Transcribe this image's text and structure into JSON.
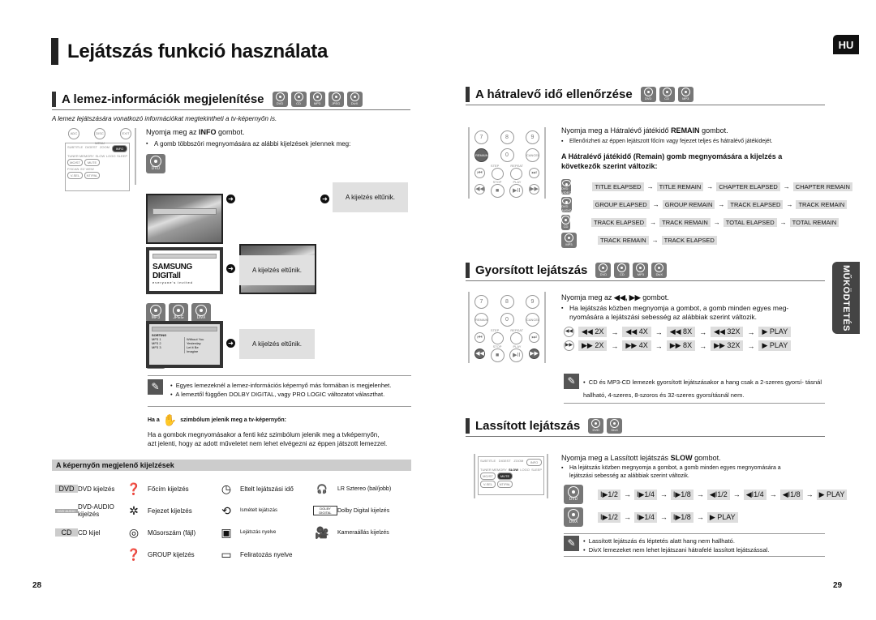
{
  "header": {
    "title": "Lejátszás funkció használata",
    "lang_tab": "HU",
    "side_tab": "MŰKÖDTETÉS"
  },
  "left": {
    "section1": {
      "title": "A lemez-információk megjelenítése",
      "discs": [
        "DVD",
        "CD",
        "MP3",
        "JPEG",
        "DivX"
      ],
      "intro": "A lemez lejátszására vonatkozó információkat megtekintheti a tv-képernyőn is.",
      "instruction_pre": "Nyomja meg az ",
      "instruction_bold": "INFO",
      "instruction_post": " gombot.",
      "bullet": "A gomb többszöri megnyomására az alábbi kijelzések jelennek meg:",
      "remote": {
        "top": [
          "ADC",
          "DISC MENU",
          "EXIT"
        ],
        "row1": [
          "SUBTITLE",
          "DIGEST",
          "ZOOM",
          "INFO"
        ],
        "row2": [
          "TUNER MEMORY",
          "SLOW",
          "LOGO",
          "SLEEP"
        ],
        "row3": [
          "P.SCAN",
          "EZ VIEW"
        ],
        "btns2": [
          "MO/ST",
          "MUTE"
        ],
        "btns3": [
          "V-SEL",
          "NT/PAL"
        ]
      },
      "dvd_label": "DVD",
      "cd_label": "CD",
      "group_discs": [
        "MP3",
        "JPEG",
        "DivX"
      ],
      "disappear": "A kijelzés eltűnik.",
      "samsung_logo": "SAMSUNG DIGITall",
      "samsung_tag": "everyone's invited",
      "mp3_screen": {
        "sorting": "SORTING",
        "files": [
          "MP3 1",
          "MP3 2",
          "MP3 3"
        ],
        "tracks": [
          "Without You",
          "Yesterday",
          "Let it Be",
          "Imagine"
        ]
      },
      "notes": [
        "Egyes lemezeknél a lemez-információs képernyő más formában is megjelenhet.",
        "A lemeztől függően DOLBY DIGITAL, vagy PRO LOGIC változatot választhat."
      ],
      "hand_pre": "Ha a",
      "hand_post": "szimbólum jelenik meg a tv-képernyőn:",
      "hand_text1": "Ha a gombok megnyomásakor a fenti kéz szimbólum jelenik meg a tvképernyőn,",
      "hand_text2": "azt jelenti, hogy az adott műveletet nem lehet elvégezni az éppen játszott lemezzel."
    },
    "legend": {
      "title": "A képernyőn megjelenő kijelzések",
      "items": [
        {
          "icon": "DVD",
          "label": "DVD kijelzés"
        },
        {
          "icon": "title-icon",
          "label": "Főcím kijelzés"
        },
        {
          "icon": "clock-icon",
          "label": "Eltelt lejátszási idő"
        },
        {
          "icon": "LR",
          "label": "LR Sztereo (bal/jobb)"
        },
        {
          "icon": "DVD AUDIO",
          "label": "DVD-AUDIO kijelzés"
        },
        {
          "icon": "chapter-icon",
          "label": "Fejezet kijelzés"
        },
        {
          "icon": "repeat-icon",
          "label": "Ismételt lejátszás"
        },
        {
          "icon": "DOLBY DIGITAL",
          "label": "Dolby Digital kijelzés"
        },
        {
          "icon": "CD",
          "label": "CD kijel"
        },
        {
          "icon": "track-icon",
          "label": "Műsorszám (fájl)"
        },
        {
          "icon": "audio-lang-icon",
          "label": "Lejátszás nyelve"
        },
        {
          "icon": "camera-icon",
          "label": "Kameraállás kijelzés"
        },
        {
          "icon": "",
          "label": ""
        },
        {
          "icon": "group-icon",
          "label": "GROUP kijelzés"
        },
        {
          "icon": "subtitle-icon",
          "label": "Feliratozás nyelve"
        },
        {
          "icon": "",
          "label": ""
        }
      ]
    },
    "page": "28"
  },
  "right": {
    "remain": {
      "title": "A hátralevő idő ellenőrzése",
      "discs": [
        "DVD",
        "CD",
        "MP3"
      ],
      "instruction_pre": "Nyomja meg a Hátralévő játékidő ",
      "instruction_bold": "REMAIN",
      "instruction_post": " gombot.",
      "bullet": "Ellenőrizheti az éppen lejátszott főcím vagy fejezet teljes és hátralévő játékidejét.",
      "subhead": "A Hátralévő játékidő (Remain) gomb megnyomására a kijelzés a következők szerint változik:",
      "rows": [
        {
          "disc": "DVD VIDEO",
          "steps": [
            "TITLE ELAPSED",
            "TITLE REMAIN",
            "CHAPTER ELAPSED",
            "CHAPTER REMAIN"
          ]
        },
        {
          "disc": "DVD AUDIO",
          "steps": [
            "GROUP ELAPSED",
            "GROUP REMAIN",
            "TRACK ELAPSED",
            "TRACK REMAIN"
          ]
        },
        {
          "disc": "CD",
          "steps": [
            "TRACK ELAPSED",
            "TRACK REMAIN",
            "TOTAL ELAPSED",
            "TOTAL REMAIN"
          ]
        },
        {
          "disc": "MP3",
          "steps": [
            "TRACK REMAIN",
            "TRACK ELAPSED"
          ]
        }
      ]
    },
    "remote2": {
      "nums": [
        "7",
        "8",
        "9"
      ],
      "row2": [
        "REMAIN",
        "0",
        "CANCEL"
      ],
      "labels1": [
        "STEP",
        "REPEAT"
      ],
      "labels2": [
        "STOP",
        "PLAY"
      ]
    },
    "fast": {
      "title": "Gyorsított lejátszás",
      "discs": [
        "DVD",
        "CD",
        "MP3",
        "DivX"
      ],
      "instruction_pre": "Nyomja meg az ",
      "instruction_bold": "◀◀, ▶▶",
      "instruction_post": " gombot.",
      "bullet": "Ha lejátszás közben megnyomja a gombot, a gomb minden egyes meg- nyomására a lejátszási sebesség az alábbiak szerint változik.",
      "rev": [
        "◀◀ 2X",
        "◀◀ 4X",
        "◀◀ 8X",
        "◀◀ 32X",
        "▶ PLAY"
      ],
      "fwd": [
        "▶▶ 2X",
        "▶▶ 4X",
        "▶▶ 8X",
        "▶▶ 32X",
        "▶ PLAY"
      ],
      "note": "CD és MP3-CD lemezek gyorsított lejátszásakor a hang csak a 2-szeres gyorsí- tásnál hallható, 4-szeres, 8-szoros és 32-szeres gyorsításnál nem."
    },
    "slow": {
      "title": "Lassított lejátszás",
      "discs": [
        "DVD",
        "DivX"
      ],
      "instruction_pre": "Nyomja meg a Lassított lejátszás ",
      "instruction_bold": "SLOW",
      "instruction_post": " gombot.",
      "bullet": "Ha lejátszás közben megnyomja a gombot, a gomb minden egyes megnyomására a lejátszási sebesség az alábbiak szerint változik.",
      "dvd": [
        "I▶1/2",
        "I▶1/4",
        "I▶1/8",
        "◀I1/2",
        "◀I1/4",
        "◀I1/8",
        "▶ PLAY"
      ],
      "divx": [
        "I▶1/2",
        "I▶1/4",
        "I▶1/8",
        "▶ PLAY"
      ],
      "notes": [
        "Lassított lejátszás és léptetés alatt hang nem hallható.",
        "DivX lemezeket nem lehet lejátszani hátrafelé lassított lejátszással."
      ]
    },
    "page": "29"
  }
}
